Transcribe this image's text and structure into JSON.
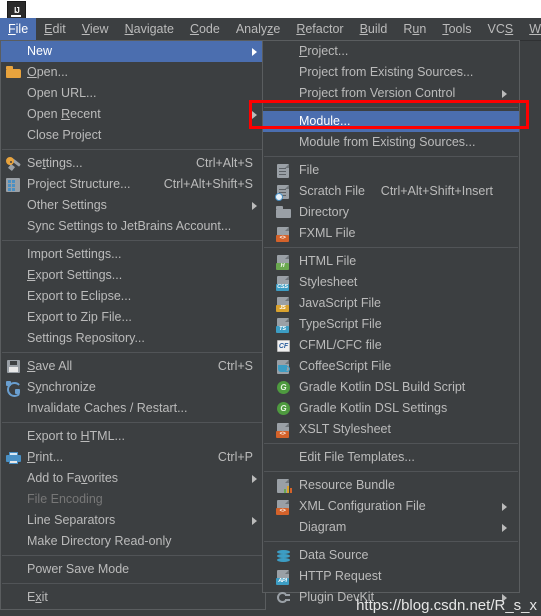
{
  "app": {
    "logo_icon": "intellij-idea-logo",
    "logo_text": "IJ"
  },
  "menubar": {
    "items": [
      {
        "label": "File",
        "mnemonic": "F",
        "selected": true
      },
      {
        "label": "Edit",
        "mnemonic": "E",
        "selected": false
      },
      {
        "label": "View",
        "mnemonic": "V",
        "selected": false
      },
      {
        "label": "Navigate",
        "mnemonic": "N",
        "selected": false
      },
      {
        "label": "Code",
        "mnemonic": "C",
        "selected": false
      },
      {
        "label": "Analyze",
        "mnemonic": "z",
        "selected": false
      },
      {
        "label": "Refactor",
        "mnemonic": "R",
        "selected": false
      },
      {
        "label": "Build",
        "mnemonic": "B",
        "selected": false
      },
      {
        "label": "Run",
        "mnemonic": "u",
        "selected": false
      },
      {
        "label": "Tools",
        "mnemonic": "T",
        "selected": false
      },
      {
        "label": "VCS",
        "mnemonic": "S",
        "selected": false
      },
      {
        "label": "Window",
        "mnemonic": "W",
        "selected": false
      }
    ]
  },
  "file_menu": {
    "items": [
      {
        "label": "New",
        "icon": null,
        "accel": "",
        "submenu": true,
        "selected": true,
        "disabled": false
      },
      {
        "label": "Open...",
        "mnemonic": "O",
        "icon": "folder-icon",
        "accel": "",
        "submenu": false
      },
      {
        "label": "Open URL...",
        "icon": null,
        "accel": "",
        "submenu": false
      },
      {
        "label": "Open Recent",
        "mnemonic": "R",
        "icon": null,
        "accel": "",
        "submenu": true
      },
      {
        "label": "Close Project",
        "icon": null,
        "accel": "",
        "submenu": false
      },
      {
        "separator": true
      },
      {
        "label": "Settings...",
        "mnemonic": "t",
        "icon": "settings-gear-icon",
        "accel": "Ctrl+Alt+S",
        "submenu": false
      },
      {
        "label": "Project Structure...",
        "icon": "project-structure-icon",
        "accel": "Ctrl+Alt+Shift+S",
        "submenu": false
      },
      {
        "label": "Other Settings",
        "icon": null,
        "accel": "",
        "submenu": true
      },
      {
        "label": "Sync Settings to JetBrains Account...",
        "icon": null,
        "accel": "",
        "submenu": false
      },
      {
        "separator": true
      },
      {
        "label": "Import Settings...",
        "icon": null,
        "accel": "",
        "submenu": false
      },
      {
        "label": "Export Settings...",
        "mnemonic": "E",
        "icon": null,
        "accel": "",
        "submenu": false
      },
      {
        "label": "Export to Eclipse...",
        "icon": null,
        "accel": "",
        "submenu": false
      },
      {
        "label": "Export to Zip File...",
        "icon": null,
        "accel": "",
        "submenu": false
      },
      {
        "label": "Settings Repository...",
        "icon": null,
        "accel": "",
        "submenu": false
      },
      {
        "separator": true
      },
      {
        "label": "Save All",
        "mnemonic": "S",
        "icon": "save-floppy-icon",
        "accel": "Ctrl+S",
        "submenu": false
      },
      {
        "label": "Synchronize",
        "mnemonic": "y",
        "icon": "synchronize-icon",
        "accel": "",
        "submenu": false
      },
      {
        "label": "Invalidate Caches / Restart...",
        "icon": null,
        "accel": "",
        "submenu": false
      },
      {
        "separator": true
      },
      {
        "label": "Export to HTML...",
        "mnemonic": "H",
        "icon": null,
        "accel": "",
        "submenu": false
      },
      {
        "label": "Print...",
        "mnemonic": "P",
        "icon": "printer-icon",
        "accel": "Ctrl+P",
        "submenu": false
      },
      {
        "label": "Add to Favorites",
        "mnemonic": "v",
        "icon": null,
        "accel": "",
        "submenu": true
      },
      {
        "label": "File Encoding",
        "icon": null,
        "accel": "",
        "submenu": false,
        "disabled": true
      },
      {
        "label": "Line Separators",
        "icon": null,
        "accel": "",
        "submenu": true
      },
      {
        "label": "Make Directory Read-only",
        "icon": null,
        "accel": "",
        "submenu": false
      },
      {
        "separator": true
      },
      {
        "label": "Power Save Mode",
        "icon": null,
        "accel": "",
        "submenu": false
      },
      {
        "separator": true
      },
      {
        "label": "Exit",
        "mnemonic": "x",
        "icon": null,
        "accel": "",
        "submenu": false
      }
    ]
  },
  "new_submenu": {
    "items": [
      {
        "label": "Project...",
        "mnemonic": "P",
        "icon": null,
        "accel": "",
        "submenu": false
      },
      {
        "label": "Project from Existing Sources...",
        "icon": null,
        "accel": "",
        "submenu": false
      },
      {
        "label": "Project from Version Control",
        "icon": null,
        "accel": "",
        "submenu": true
      },
      {
        "separator": true
      },
      {
        "label": "Module...",
        "mnemonic": "M",
        "icon": null,
        "accel": "",
        "submenu": false,
        "selected": true
      },
      {
        "label": "Module from Existing Sources...",
        "icon": null,
        "accel": "",
        "submenu": false
      },
      {
        "separator": true
      },
      {
        "label": "File",
        "icon": "file-page-icon",
        "accel": "",
        "submenu": false
      },
      {
        "label": "Scratch File",
        "icon": "scratch-file-icon",
        "accel": "Ctrl+Alt+Shift+Insert",
        "submenu": false
      },
      {
        "label": "Directory",
        "icon": "directory-folder-icon",
        "accel": "",
        "submenu": false
      },
      {
        "label": "FXML File",
        "icon": "fxml-file-icon",
        "accel": "",
        "submenu": false,
        "badge": "<>",
        "badge_color": "#d4622a"
      },
      {
        "separator": true
      },
      {
        "label": "HTML File",
        "icon": "html-file-icon",
        "accel": "",
        "submenu": false,
        "badge": "H",
        "badge_color": "#6aa84f"
      },
      {
        "label": "Stylesheet",
        "icon": "css-file-icon",
        "accel": "",
        "submenu": false,
        "badge": "CSS",
        "badge_color": "#3c9dc4"
      },
      {
        "label": "JavaScript File",
        "icon": "javascript-file-icon",
        "accel": "",
        "submenu": false,
        "badge": "JS",
        "badge_color": "#d9a22e"
      },
      {
        "label": "TypeScript File",
        "icon": "typescript-file-icon",
        "accel": "",
        "submenu": false,
        "badge": "TS",
        "badge_color": "#3c9dc4"
      },
      {
        "label": "CFML/CFC file",
        "icon": "cfml-file-icon",
        "accel": "",
        "submenu": false
      },
      {
        "label": "CoffeeScript File",
        "icon": "coffeescript-file-icon",
        "accel": "",
        "submenu": false
      },
      {
        "label": "Gradle Kotlin DSL Build Script",
        "icon": "gradle-icon",
        "accel": "",
        "submenu": false
      },
      {
        "label": "Gradle Kotlin DSL Settings",
        "icon": "gradle-icon",
        "accel": "",
        "submenu": false
      },
      {
        "label": "XSLT Stylesheet",
        "icon": "xslt-file-icon",
        "accel": "",
        "submenu": false,
        "badge": "<>",
        "badge_color": "#d4622a"
      },
      {
        "separator": true
      },
      {
        "label": "Edit File Templates...",
        "icon": null,
        "accel": "",
        "submenu": false
      },
      {
        "separator": true
      },
      {
        "label": "Resource Bundle",
        "icon": "resource-bundle-icon",
        "accel": "",
        "submenu": false
      },
      {
        "label": "XML Configuration File",
        "icon": "xml-config-file-icon",
        "accel": "",
        "submenu": true,
        "badge": "<>",
        "badge_color": "#d4622a"
      },
      {
        "label": "Diagram",
        "icon": null,
        "accel": "",
        "submenu": true
      },
      {
        "separator": true
      },
      {
        "label": "Data Source",
        "icon": "data-source-icon",
        "accel": "",
        "submenu": false
      },
      {
        "label": "HTTP Request",
        "icon": "http-request-icon",
        "accel": "",
        "submenu": false,
        "badge": "API",
        "badge_color": "#3c9dc4"
      },
      {
        "label": "Plugin DevKit",
        "icon": "plugin-devkit-icon",
        "accel": "",
        "submenu": true
      }
    ]
  },
  "annotation": {
    "highlight_color": "#ff0000",
    "highlight_target": "Module..."
  },
  "watermark": {
    "text": "https://blog.csdn.net/R_s_x"
  },
  "colors": {
    "menu_background": "#3c3f41",
    "selection": "#4b6eaf",
    "text": "#bbbbbb",
    "disabled_text": "#777777",
    "separator": "#515457",
    "titlebar": "#ffffff"
  }
}
